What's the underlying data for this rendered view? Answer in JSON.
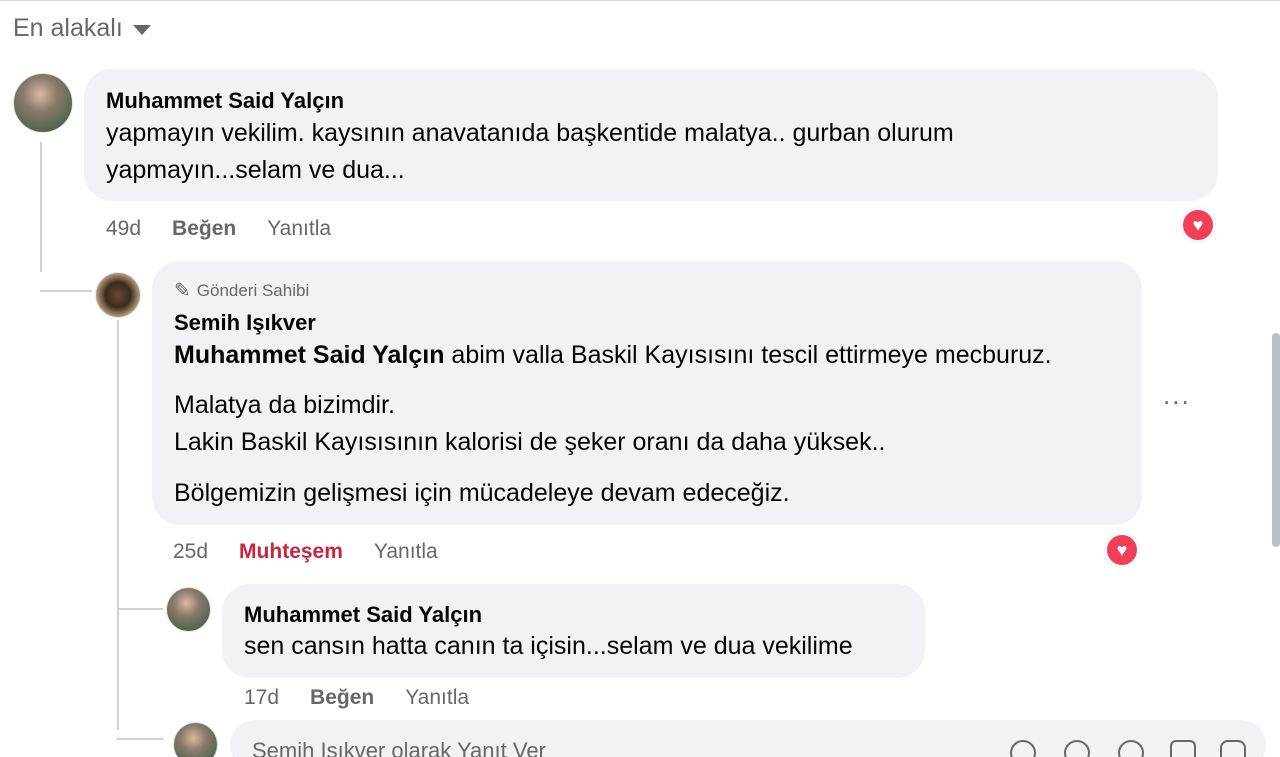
{
  "sort": {
    "label": "En alakalı"
  },
  "comments": [
    {
      "author": "Muhammet Said Yalçın",
      "lines": [
        "yapmayın vekilim. kaysının anavatanıda başkentide malatya.. gurban olurum",
        "yapmayın...selam ve dua..."
      ],
      "time": "49d",
      "like_label": "Beğen",
      "reply_label": "Yanıtla",
      "reaction": "heart"
    },
    {
      "owner_tag": "Gönderi Sahibi",
      "author": "Semih Işıkver",
      "mention": "Muhammet Said Yalçın",
      "line1_rest": " abim valla Baskil Kayısısını tescil ettirmeye mecburuz.",
      "para2": [
        "Malatya da bizimdir.",
        "Lakin Baskil Kayısısının kalorisi de şeker oranı da daha yüksek.."
      ],
      "para3": "Bölgemizin gelişmesi için mücadeleye devam edeceğiz.",
      "time": "25d",
      "like_label": "Muhteşem",
      "reply_label": "Yanıtla",
      "reaction": "heart",
      "more_label": "..."
    },
    {
      "author": "Muhammet Said Yalçın",
      "lines": [
        "sen cansın hatta canın ta içisin...selam ve dua vekilime"
      ],
      "time": "17d",
      "like_label": "Beğen",
      "reply_label": "Yanıtla"
    }
  ],
  "reply_box": {
    "placeholder": "Semih Işıkver olarak Yanıt Ver"
  },
  "colors": {
    "heart": "#f33e58",
    "muhtesem": "#c9253d",
    "bubble": "#f0f2f5",
    "muted": "#65676b"
  }
}
